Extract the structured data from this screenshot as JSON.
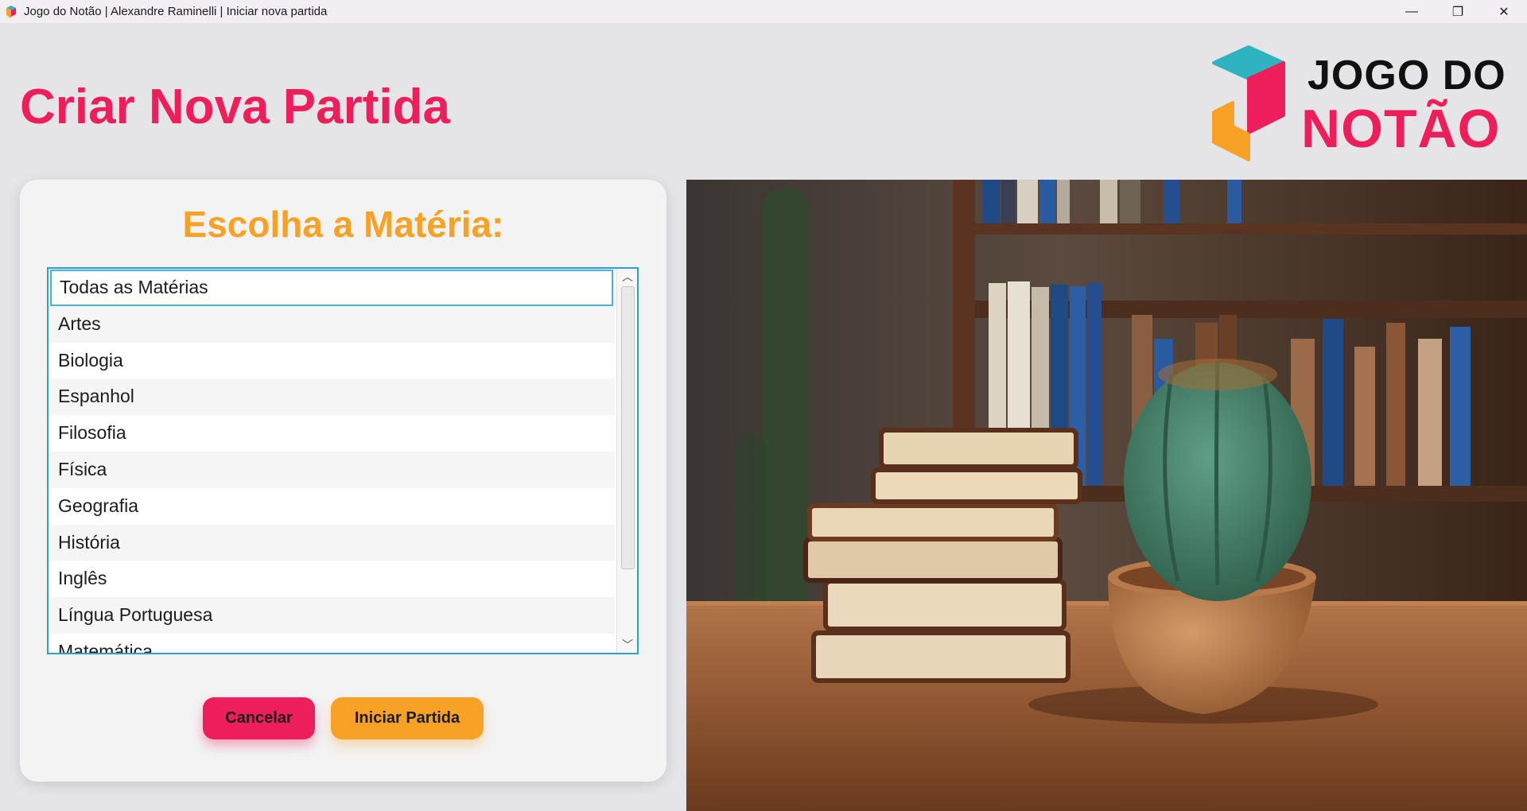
{
  "window": {
    "title": "Jogo do Notão | Alexandre Raminelli | Iniciar nova partida",
    "minimize": "—",
    "restore": "❐",
    "close": "✕"
  },
  "header": {
    "title": "Criar Nova Partida",
    "logo_line1": "JOGO DO",
    "logo_line2": "NOTÃO"
  },
  "panel": {
    "heading": "Escolha a Matéria:",
    "subjects": [
      "Todas as Matérias",
      "Artes",
      "Biologia",
      "Espanhol",
      "Filosofia",
      "Física",
      "Geografia",
      "História",
      "Inglês",
      "Língua Portuguesa",
      "Matemática"
    ],
    "selected_index": 0,
    "cancel_label": "Cancelar",
    "start_label": "Iniciar Partida"
  },
  "colors": {
    "accent_pink": "#ee1e5a",
    "accent_orange": "#f7a224",
    "accent_teal": "#2fb3c0",
    "list_border": "#2aa1d6"
  }
}
